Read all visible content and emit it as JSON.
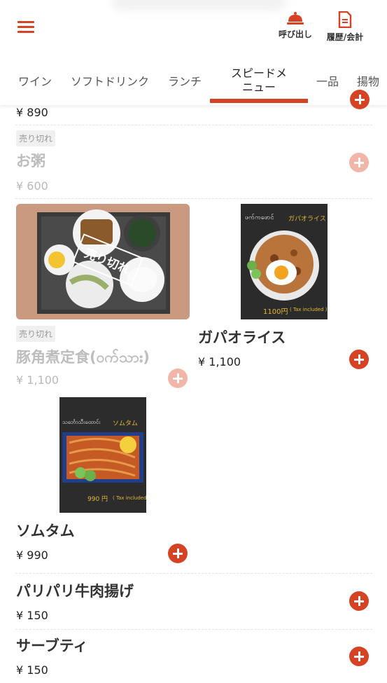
{
  "header": {
    "call_label": "呼び出し",
    "history_label": "履歴/会計",
    "menu_icon": "hamburger-icon",
    "call_icon": "bell-icon",
    "history_icon": "document-icon",
    "accent_color": "#d54324"
  },
  "tabs": [
    {
      "label": "ワイン"
    },
    {
      "label": "ソフトドリンク"
    },
    {
      "label": "ランチ"
    },
    {
      "label": "スピードメ",
      "label2": "ニュー",
      "active": true
    },
    {
      "label": "一品"
    },
    {
      "label": "揚物"
    }
  ],
  "items": {
    "prev": {
      "price": "¥ 890"
    },
    "okayu": {
      "sold_out": "売り切れ",
      "name": "お粥",
      "price": "¥ 600"
    },
    "pork": {
      "sold_out": "売り切れ",
      "name": "豚角煮定食(ဝက်သား)",
      "price": "¥ 1,100",
      "stamp": "売り切れ"
    },
    "gapao": {
      "name": "ガパオライス",
      "price": "¥ 1,100",
      "photo_title_mm": "ဖက်ကဖောင်",
      "photo_title_jp": "ガパオライス",
      "photo_price": "1100円",
      "photo_tax": "( Tax included )"
    },
    "somtam": {
      "name": "ソムタム",
      "price": "¥ 990",
      "photo_title_mm": "သင်္ဘောသီးထောင်း",
      "photo_title_jp": "ソムタム",
      "photo_price": "990 円",
      "photo_tax": "( Tax included )"
    },
    "paripari": {
      "name": "パリパリ牛肉揚げ",
      "price": "¥ 150"
    },
    "saabutei": {
      "name": "サーブティ",
      "price": "¥ 150"
    }
  }
}
